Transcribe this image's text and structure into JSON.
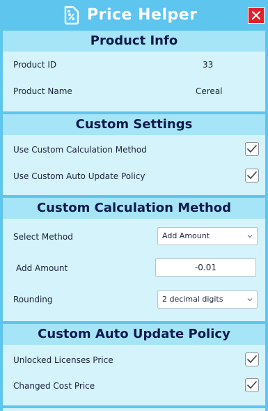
{
  "window": {
    "title": "Price Helper",
    "title_icon": "price-tag-icon",
    "close_icon": "close-icon"
  },
  "sections": {
    "product_info": {
      "header": "Product Info",
      "product_id_label": "Product ID",
      "product_id_value": "33",
      "product_name_label": "Product Name",
      "product_name_value": "Cereal"
    },
    "custom_settings": {
      "header": "Custom Settings",
      "use_custom_calc_label": "Use Custom Calculation Method",
      "use_custom_calc_checked": true,
      "use_custom_auto_update_label": "Use Custom Auto Update Policy",
      "use_custom_auto_update_checked": true
    },
    "custom_calculation": {
      "header": "Custom Calculation Method",
      "select_method_label": "Select Method",
      "select_method_value": "Add Amount",
      "add_amount_label": "Add Amount",
      "add_amount_value": "-0.01",
      "rounding_label": "Rounding",
      "rounding_value": "2 decimal digits"
    },
    "custom_auto_update": {
      "header": "Custom Auto Update Policy",
      "unlocked_licenses_label": "Unlocked Licenses Price",
      "unlocked_licenses_checked": true,
      "changed_cost_label": "Changed Cost Price",
      "changed_cost_checked": true
    }
  },
  "colors": {
    "frame": "#5ec5ee",
    "panel": "#d4f3fb",
    "section_header": "#a6e4f7",
    "header_text": "#0e1a4d",
    "close_button": "#e3202a"
  }
}
